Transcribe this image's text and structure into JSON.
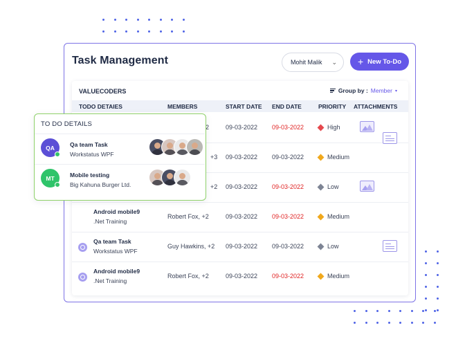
{
  "app": {
    "title": "Task Management",
    "member_select": "Mohit Malik",
    "new_button": "New To-Do"
  },
  "panel": {
    "company": "VALUECODERS",
    "group_by_label": "Group by :",
    "group_by_value": "Member"
  },
  "columns": [
    "TODO DETAIES",
    "MEMBERS",
    "START DATE",
    "END DATE",
    "PRIORITY",
    "ATTACHMENTS"
  ],
  "rows": [
    {
      "title": "",
      "subtitle": "",
      "members": "2",
      "start": "09-03-2022",
      "end": "09-03-2022",
      "end_overdue": true,
      "priority": "High",
      "attachments": [
        "image",
        "document"
      ]
    },
    {
      "title": "",
      "subtitle": "",
      "members": "+3",
      "start": "09-03-2022",
      "end": "09-03-2022",
      "end_overdue": false,
      "priority": "Medium",
      "attachments": []
    },
    {
      "title": "",
      "subtitle": "",
      "members": "+2",
      "start": "09-03-2022",
      "end": "09-03-2022",
      "end_overdue": true,
      "priority": "Low",
      "attachments": [
        "image"
      ]
    },
    {
      "title": "Android mobile9",
      "subtitle": ".Net Training",
      "members": "Robert Fox, +2",
      "start": "09-03-2022",
      "end": "09-03-2022",
      "end_overdue": true,
      "priority": "Medium",
      "attachments": []
    },
    {
      "title": "Qa team Task",
      "subtitle": "Workstatus WPF",
      "members": "Guy Hawkins, +2",
      "start": "09-03-2022",
      "end": "09-03-2022",
      "end_overdue": false,
      "priority": "Low",
      "attachments": [
        "document"
      ]
    },
    {
      "title": "Android mobile9",
      "subtitle": ".Net Training",
      "members": "Robert Fox, +2",
      "start": "09-03-2022",
      "end": "09-03-2022",
      "end_overdue": true,
      "priority": "Medium",
      "attachments": []
    }
  ],
  "popup": {
    "title": "TO DO DETAILS",
    "items": [
      {
        "initials": "QA",
        "color": "#5b4fd6",
        "title": "Qa team Task",
        "subtitle": "Workstatus WPF"
      },
      {
        "initials": "MT",
        "color": "#2fc46a",
        "title": "Mobile testing",
        "subtitle": "Big Kahuna Burger Ltd."
      }
    ]
  },
  "colors": {
    "accent": "#6557e8",
    "overdue": "#e02424",
    "popup_border": "#8fd16a",
    "high": "#e5484d",
    "medium": "#f0a81c",
    "low": "#7d8494"
  }
}
